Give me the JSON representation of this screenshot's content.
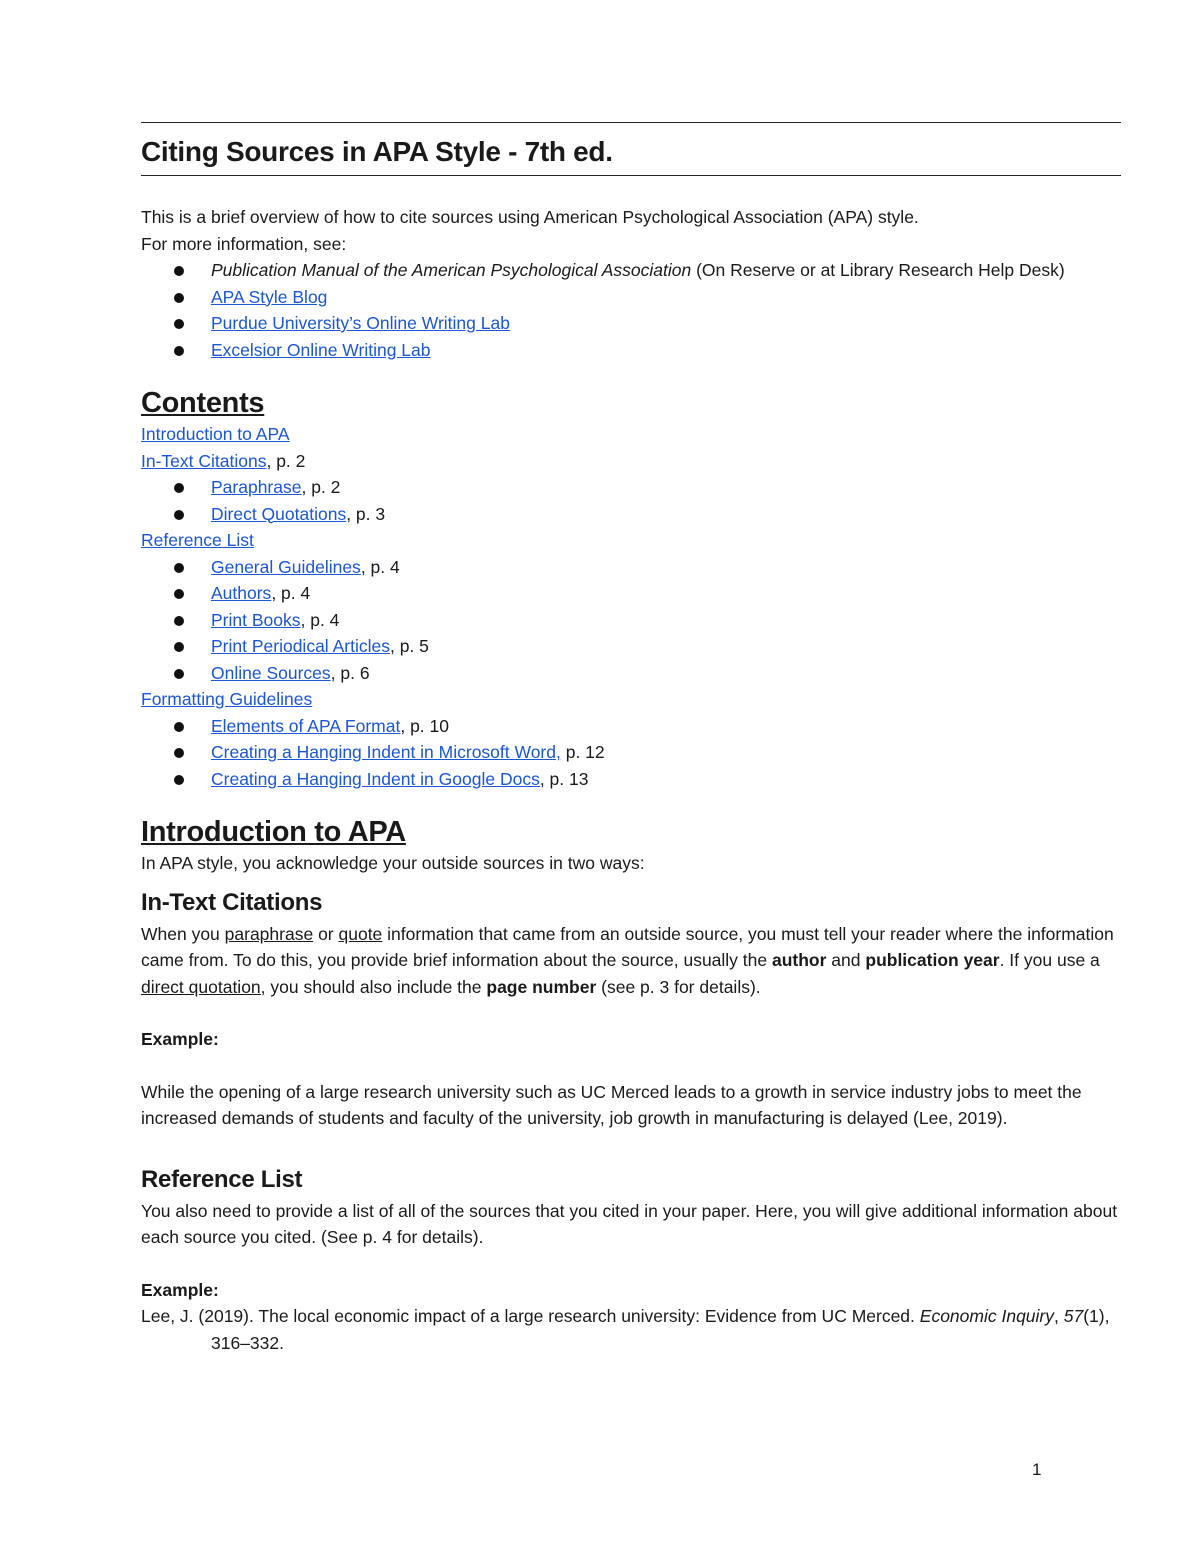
{
  "document": {
    "title": "Citing Sources in APA Style - 7th ed.",
    "intro_line": "This is a brief overview of how to cite sources using American Psychological Association (APA) style.",
    "more_info_label": "For more information, see:",
    "resources": [
      {
        "italic": "Publication Manual of the American Psychological Association",
        "rest": " (On Reserve or at Library Research Help Desk)"
      },
      {
        "link": "APA Style Blog"
      },
      {
        "link": "Purdue University’s Online Writing Lab"
      },
      {
        "link": "Excelsior Online Writing Lab"
      }
    ],
    "contents": {
      "heading": "Contents",
      "intro_link": "Introduction to APA",
      "in_text": {
        "link": "In-Text Citations",
        "page": ", p. 2"
      },
      "in_text_items": [
        {
          "link": "Paraphrase",
          "page": ", p. 2"
        },
        {
          "link": "Direct Quotations",
          "page": ", p. 3"
        }
      ],
      "reference_list_link": "Reference List",
      "reference_items": [
        {
          "link": "General Guidelines",
          "page": ", p. 4"
        },
        {
          "link": "Authors",
          "page": ", p. 4"
        },
        {
          "link": "Print Books",
          "page": ", p. 4"
        },
        {
          "link": "Print Periodical Articles",
          "page": ", p. 5"
        },
        {
          "link": "Online Sources",
          "page": ", p. 6"
        }
      ],
      "formatting_link": "Formatting Guidelines",
      "formatting_items": [
        {
          "link": "Elements of APA Format",
          "page": ", p. 10"
        },
        {
          "link": "Creating a Hanging Indent in Microsoft Word,",
          "page": " p. 12"
        },
        {
          "link": "Creating a Hanging Indent in Google Docs",
          "page": ", p. 13"
        }
      ]
    },
    "intro_section": {
      "heading": "Introduction to APA",
      "text": "In APA style, you acknowledge your outside sources in two ways:"
    },
    "in_text_section": {
      "heading": "In-Text Citations",
      "p1": "When you ",
      "u1": "paraphrase",
      "p2": " or ",
      "u2": "quote",
      "p3": " information that came from an outside source, you must tell your reader where the information came from. To do this, you provide brief information about the source, usually the ",
      "b1": "author",
      "p4": " and ",
      "b2": "publication year",
      "p5": ". If you use a ",
      "u3": "direct quotation,",
      "p6": " you should also include the ",
      "b3": "page number",
      "p7": " (see p. 3 for details).",
      "example_label": "Example:",
      "example_text": "While the opening of a large research university such as UC Merced leads to a growth in service industry jobs to meet the increased demands of students and faculty of the university, job growth in manufacturing is delayed (Lee, 2019)."
    },
    "reference_section": {
      "heading": "Reference List",
      "text": "You also need to provide a list of all of the sources that you cited in your paper. Here, you will give additional information about each source you cited. (See p. 4 for details).",
      "example_label": "Example:",
      "ref_plain": "Lee, J. (2019). The local economic impact of a large research university: Evidence from UC Merced. ",
      "ref_journal": "Economic Inquiry",
      "ref_sep": ", ",
      "ref_volume": "57",
      "ref_rest": "(1), 316–332."
    },
    "page_number": "1"
  }
}
